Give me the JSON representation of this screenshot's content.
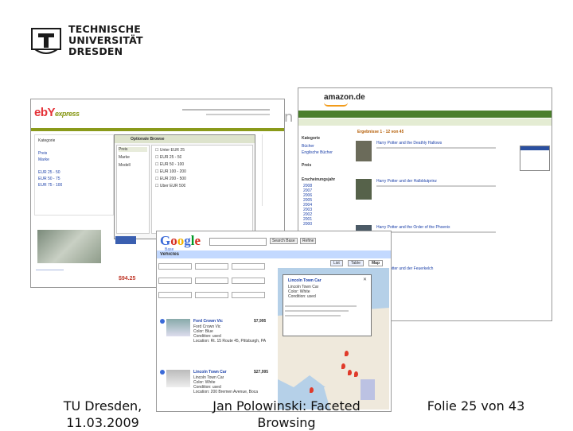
{
  "header": {
    "university_lines": [
      "TECHNISCHE",
      "UNIVERSITÄT",
      "DRESDEN"
    ],
    "slide_title_partial": "on"
  },
  "screenshots": {
    "ebay": {
      "logo_main": "ebY",
      "logo_sub": "express",
      "panel_title": "Optionale Browse",
      "panel_left_items": [
        "Preis",
        "Marke",
        "Modell"
      ],
      "panel_right_items": [
        "Unter EUR 25",
        "EUR 25 - 50",
        "EUR 50 - 100",
        "EUR 100 - 200",
        "EUR 200 - 500",
        "Über EUR 500"
      ],
      "sidebar_items": [
        "Kategorie",
        "Preis",
        "Marke",
        "EUR 25 - 50",
        "EUR 50 - 75",
        "EUR 75 - 100"
      ],
      "price": "$94.25"
    },
    "amazon": {
      "logo": "amazon.de",
      "results_title": "Ergebnisse 1 - 12 von 45",
      "sidebar_items": [
        "Kategorie",
        "Bücher",
        "Englische Bücher",
        "Preis",
        "Erscheinungsjahr"
      ],
      "years": [
        "2008",
        "2007",
        "2006",
        "2005",
        "2004",
        "2003",
        "2002",
        "2001",
        "2000"
      ],
      "results": [
        "Harry Potter and the Deathly Hallows",
        "Harry Potter und der Halbblutprinz",
        "Harry Potter and the Order of the Phoenix",
        "Harry Potter und der Feuerkelch"
      ]
    },
    "google": {
      "logo": "Google",
      "logo_sub": "Base",
      "section": "Vehicles",
      "buttons": [
        "Search Base",
        "Refine"
      ],
      "tabs": [
        "List",
        "Table",
        "Map"
      ],
      "map_popup_title": "Lincoln Town Car",
      "listings": [
        {
          "title": "Ford Crown Vic",
          "price": "$7,995",
          "lines": [
            "Ford Crown Vic",
            "Color: Blue",
            "Condition: used",
            "Location: Rt. 15 Route 45, Pittsburgh, PA"
          ]
        },
        {
          "title": "Lincoln Town Car",
          "price": "$27,995",
          "lines": [
            "Lincoln Town Car",
            "Color: White",
            "Condition: used",
            "Location: 200 Bremen Avenue, Boca"
          ]
        }
      ]
    }
  },
  "footer": {
    "left_line1": "TU Dresden,",
    "left_line2": "11.03.2009",
    "center_line1": "Jan Polowinski: Faceted",
    "center_line2": "Browsing",
    "right": "Folie 25 von 43"
  }
}
